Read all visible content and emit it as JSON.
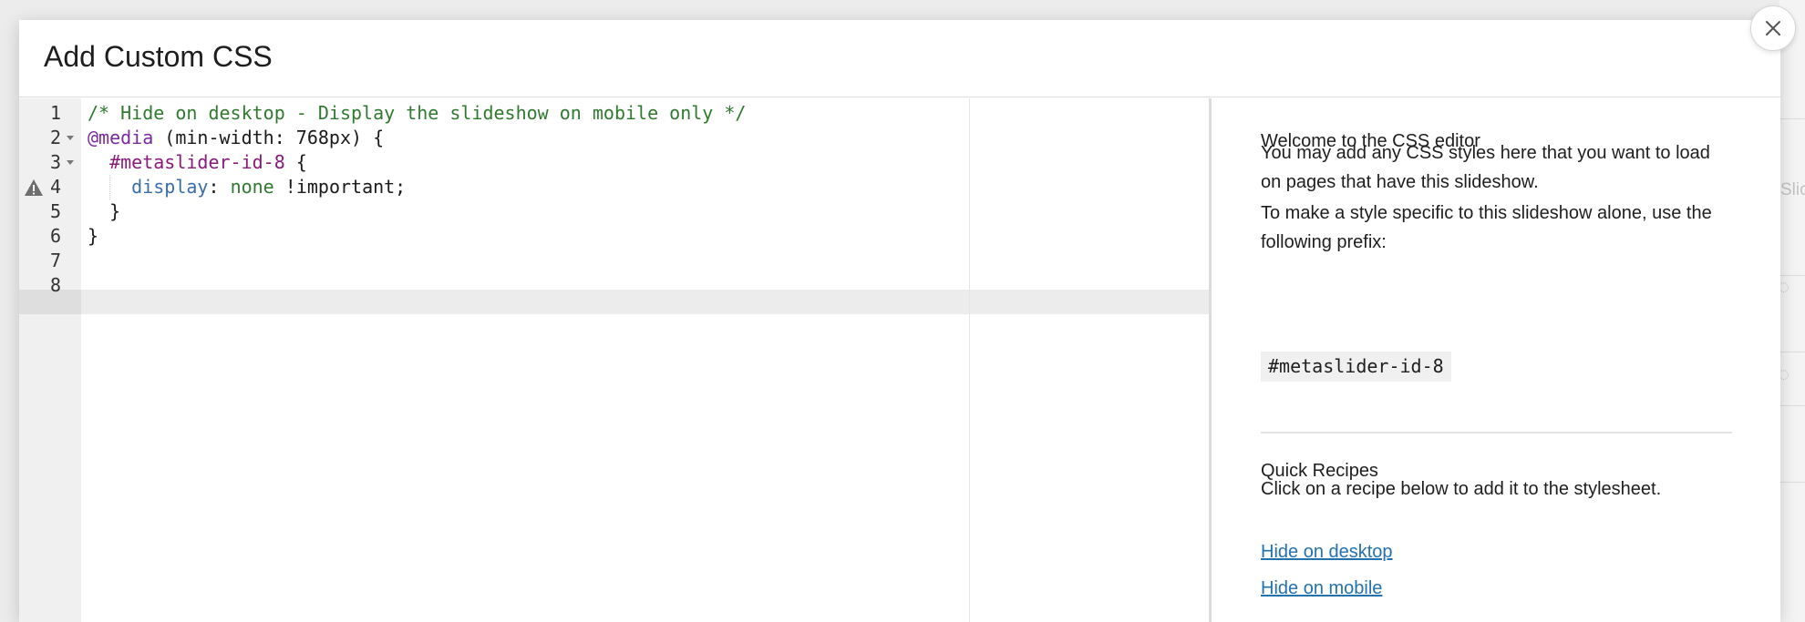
{
  "modal": {
    "title": "Add Custom CSS",
    "close_icon": "close-icon"
  },
  "editor": {
    "line_numbers": [
      "1",
      "2",
      "3",
      "4",
      "5",
      "6",
      "7",
      "8"
    ],
    "active_line": 8,
    "warning_line": 4,
    "warning_icon": "warning-icon",
    "fold_lines": [
      2,
      3
    ],
    "lines": [
      [
        {
          "t": "/* Hide on desktop - Display the slideshow on mobile only */",
          "c": "comment"
        }
      ],
      [
        {
          "t": "@media",
          "c": "at"
        },
        {
          "t": " (min-width: 768px) {",
          "c": "plain"
        }
      ],
      [
        {
          "t": "  ",
          "c": "plain"
        },
        {
          "t": "#metaslider-id-8",
          "c": "selector"
        },
        {
          "t": " {",
          "c": "plain"
        }
      ],
      [
        {
          "t": "    ",
          "c": "plain"
        },
        {
          "t": "display",
          "c": "prop"
        },
        {
          "t": ": ",
          "c": "plain"
        },
        {
          "t": "none",
          "c": "value"
        },
        {
          "t": " !important;",
          "c": "plain"
        }
      ],
      [
        {
          "t": "  }",
          "c": "plain"
        }
      ],
      [
        {
          "t": "}",
          "c": "plain"
        }
      ],
      [
        {
          "t": "",
          "c": "plain"
        }
      ],
      [
        {
          "t": "",
          "c": "plain"
        }
      ]
    ]
  },
  "sidebar": {
    "welcome_heading": "Welcome to the CSS editor",
    "welcome_text": "You may add any CSS styles here that you want to load on pages that have this slideshow.",
    "prefix_text": "To make a style specific to this slideshow alone, use the following prefix:",
    "prefix_code": "#metaslider-id-8",
    "recipes_heading": "Quick Recipes",
    "recipes_text": "Click on a recipe below to add it to the stylesheet.",
    "recipes": [
      {
        "label": "Hide on desktop"
      },
      {
        "label": "Hide on mobile"
      }
    ]
  },
  "background": {
    "right_text": "Slic"
  },
  "colors": {
    "link": "#2271b1",
    "comment": "#2f7a2f",
    "selector": "#8a1a7a",
    "property": "#3a6ea8"
  }
}
